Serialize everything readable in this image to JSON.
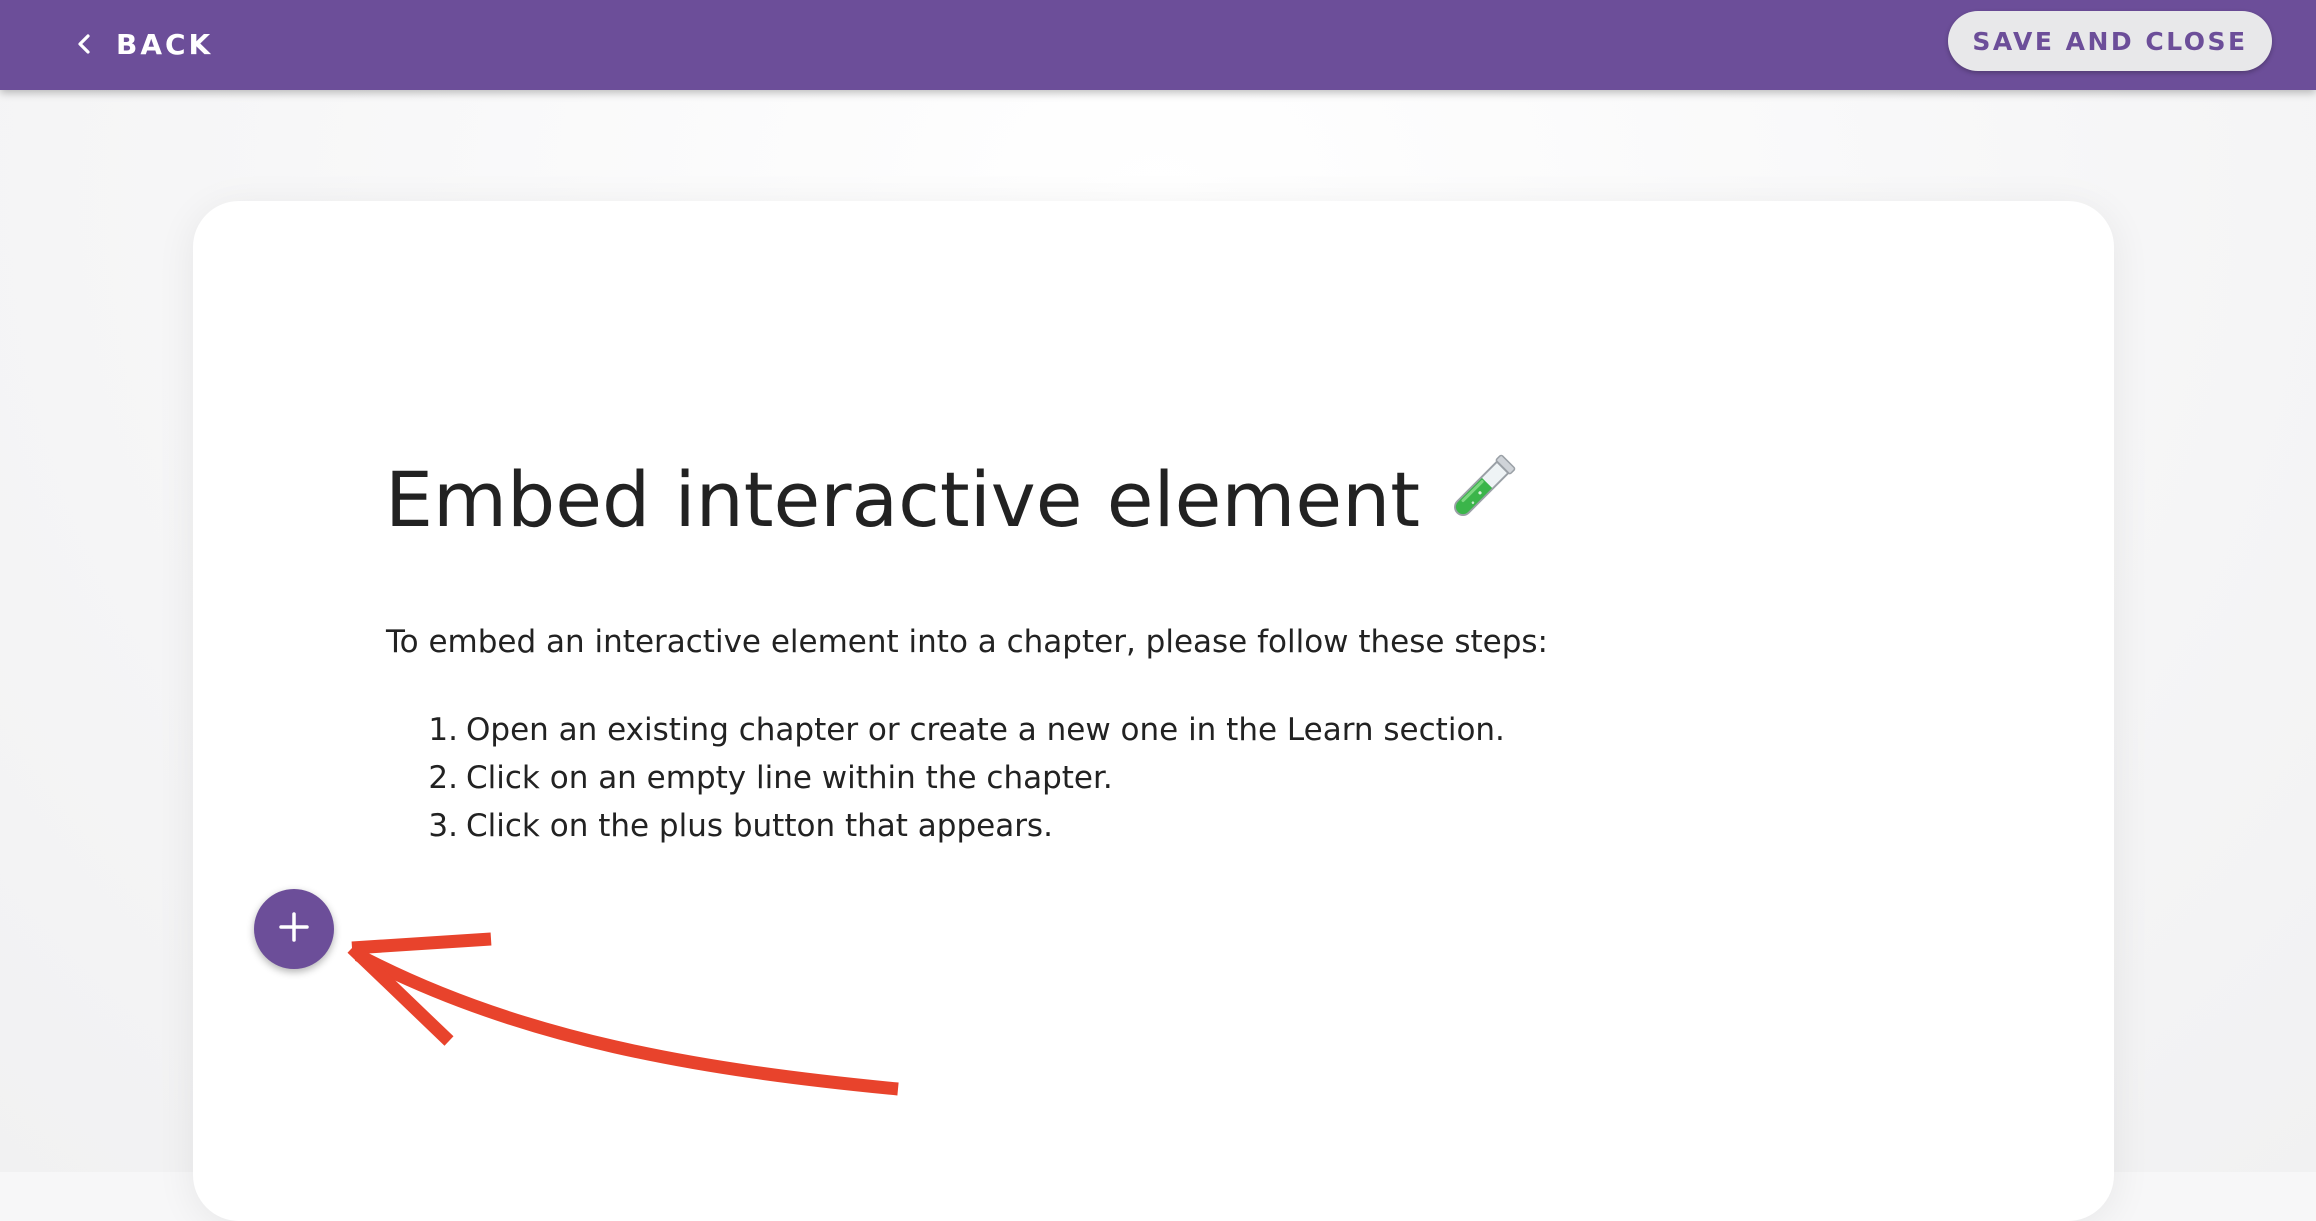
{
  "header": {
    "back_label": "BACK",
    "save_label": "SAVE AND CLOSE"
  },
  "content": {
    "title": "Embed interactive element",
    "title_emoji": "test-tube-icon",
    "intro": "To embed an interactive element into a chapter, please follow these steps:",
    "steps": [
      {
        "num": "1.",
        "text": "Open an existing chapter or create a new one in the Learn section."
      },
      {
        "num": "2.",
        "text": "Click on an empty line within the chapter."
      },
      {
        "num": "3.",
        "text": "Click on the plus button that appears."
      }
    ]
  },
  "plus_button": {
    "icon": "plus-icon"
  },
  "annotation": {
    "icon": "red-arrow-annotation"
  },
  "colors": {
    "brand": "#6c4e99",
    "save_button_bg": "#e8e8ea",
    "arrow": "#e8432c"
  }
}
